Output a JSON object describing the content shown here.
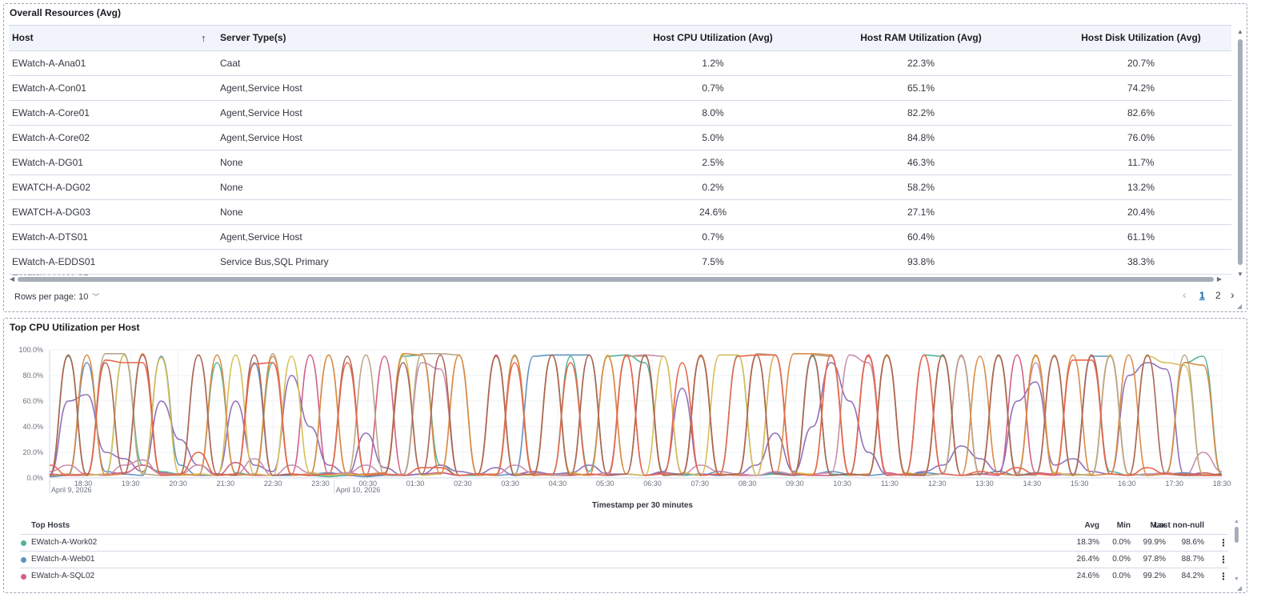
{
  "table_panel": {
    "title": "Overall Resources (Avg)",
    "columns": [
      "Host",
      "Server Type(s)",
      "Host CPU Utilization (Avg)",
      "Host RAM Utilization (Avg)",
      "Host Disk Utilization (Avg)"
    ],
    "sort_icon": "arrow-up-icon",
    "rows": [
      [
        "EWatch-A-Ana01",
        "Caat",
        "1.2%",
        "22.3%",
        "20.7%"
      ],
      [
        "EWatch-A-Con01",
        "Agent,Service Host",
        "0.7%",
        "65.1%",
        "74.2%"
      ],
      [
        "EWatch-A-Core01",
        "Agent,Service Host",
        "8.0%",
        "82.2%",
        "82.6%"
      ],
      [
        "EWatch-A-Core02",
        "Agent,Service Host",
        "5.0%",
        "84.8%",
        "76.0%"
      ],
      [
        "EWatch-A-DG01",
        "None",
        "2.5%",
        "46.3%",
        "11.7%"
      ],
      [
        "EWATCH-A-DG02",
        "None",
        "0.2%",
        "58.2%",
        "13.2%"
      ],
      [
        "EWATCH-A-DG03",
        "None",
        "24.6%",
        "27.1%",
        "20.4%"
      ],
      [
        "EWatch-A-DTS01",
        "Agent,Service Host",
        "0.7%",
        "60.4%",
        "61.1%"
      ],
      [
        "EWatch-A-EDDS01",
        "Service Bus,SQL Primary",
        "7.5%",
        "93.8%",
        "38.3%"
      ]
    ],
    "rows_per_page_label": "Rows per page: 10",
    "pages": [
      "1",
      "2"
    ],
    "current_page": "1"
  },
  "chart_panel": {
    "title": "Top CPU Utilization per Host",
    "legend_title": "Top Hosts",
    "legend_columns": [
      "Avg",
      "Min",
      "Max",
      "Last non-null"
    ],
    "legend_rows": [
      {
        "name": "EWatch-A-Work02",
        "color": "#54b399",
        "avg": "18.3%",
        "min": "0.0%",
        "max": "99.9%",
        "last": "98.6%"
      },
      {
        "name": "EWatch-A-Web01",
        "color": "#6092c0",
        "avg": "26.4%",
        "min": "0.0%",
        "max": "97.8%",
        "last": "88.7%"
      },
      {
        "name": "EWatch-A-SQL02",
        "color": "#d36086",
        "avg": "24.6%",
        "min": "0.0%",
        "max": "99.2%",
        "last": "84.2%"
      }
    ]
  },
  "chart_data": {
    "type": "line",
    "title": "Top CPU Utilization per Host",
    "xlabel": "Timestamp per 30 minutes",
    "ylabel": "",
    "y_ticks": [
      "0.0%",
      "20.0%",
      "40.0%",
      "60.0%",
      "80.0%",
      "100.0%"
    ],
    "ylim": [
      0,
      100
    ],
    "x_ticks": [
      "18:30",
      "19:30",
      "20:30",
      "21:30",
      "22:30",
      "23:30",
      "00:30",
      "01:30",
      "02:30",
      "03:30",
      "04:30",
      "05:30",
      "06:30",
      "07:30",
      "08:30",
      "09:30",
      "10:30",
      "11:30",
      "12:30",
      "13:30",
      "14:30",
      "15:30",
      "16:30",
      "17:30",
      "18:30"
    ],
    "x_date_labels": [
      {
        "at": "18:30",
        "text": "April 9, 2026"
      },
      {
        "at": "00:30",
        "text": "April 10, 2026"
      }
    ],
    "series_colors": [
      "#54b399",
      "#6092c0",
      "#d36086",
      "#9170b8",
      "#ca8eae",
      "#d6bf57",
      "#b9a888",
      "#da8b45",
      "#aa6556",
      "#e7664c"
    ],
    "series": [
      {
        "values": [
          2,
          95,
          3,
          2,
          96,
          10,
          5,
          3,
          2,
          90,
          4,
          2,
          90,
          3,
          2,
          1,
          2,
          3,
          4,
          95,
          96,
          10,
          2,
          2,
          3,
          96,
          4,
          2,
          95,
          5,
          95,
          96,
          90,
          4,
          2,
          3,
          2,
          96,
          2,
          3,
          2,
          95,
          3,
          2,
          96,
          2,
          3,
          96,
          95,
          2,
          3,
          5,
          2,
          96,
          4,
          2,
          96,
          5,
          2,
          3,
          4,
          90,
          95,
          3
        ]
      },
      {
        "values": [
          1,
          2,
          90,
          5,
          3,
          2,
          95,
          10,
          2,
          2,
          3,
          90,
          2,
          2,
          3,
          4,
          2,
          1,
          2,
          2,
          3,
          4,
          2,
          3,
          2,
          3,
          95,
          96,
          96,
          96,
          2,
          3,
          2,
          4,
          3,
          2,
          5,
          3,
          2,
          4,
          2,
          3,
          5,
          3,
          2,
          3,
          2,
          4,
          3,
          2,
          3,
          5,
          2,
          4,
          3,
          2,
          95,
          95,
          3,
          2,
          3,
          4,
          2,
          2
        ]
      },
      {
        "values": [
          3,
          2,
          2,
          3,
          4,
          10,
          4,
          2,
          3,
          2,
          12,
          2,
          2,
          3,
          96,
          3,
          4,
          2,
          95,
          2,
          3,
          4,
          2,
          3,
          96,
          3,
          5,
          2,
          2,
          3,
          2,
          96,
          2,
          4,
          2,
          96,
          3,
          2,
          2,
          96,
          3,
          2,
          2,
          3,
          96,
          4,
          2,
          2,
          3,
          95,
          3,
          2,
          96,
          4,
          3,
          3,
          2,
          96,
          3,
          2,
          3,
          2,
          4,
          2
        ]
      },
      {
        "values": [
          2,
          60,
          65,
          20,
          15,
          5,
          60,
          30,
          10,
          3,
          60,
          10,
          5,
          80,
          40,
          10,
          3,
          35,
          8,
          2,
          3,
          10,
          5,
          3,
          8,
          2,
          5,
          3,
          4,
          10,
          3,
          3,
          2,
          5,
          70,
          3,
          2,
          3,
          10,
          35,
          5,
          40,
          90,
          60,
          20,
          3,
          2,
          5,
          10,
          25,
          15,
          5,
          60,
          75,
          10,
          15,
          5,
          3,
          80,
          90,
          85,
          2,
          3,
          2
        ]
      },
      {
        "values": [
          5,
          10,
          3,
          2,
          10,
          14,
          3,
          3,
          10,
          2,
          3,
          15,
          2,
          10,
          4,
          2,
          4,
          10,
          3,
          2,
          90,
          85,
          2,
          3,
          3,
          10,
          4,
          2,
          3,
          2,
          4,
          95,
          96,
          95,
          3,
          10,
          5,
          3,
          2,
          5,
          3,
          3,
          4,
          96,
          90,
          3,
          2,
          96,
          4,
          95,
          3,
          96,
          4,
          90,
          2,
          3,
          95,
          3,
          2,
          3,
          4,
          2,
          20,
          5
        ]
      },
      {
        "values": [
          2,
          96,
          2,
          3,
          96,
          4,
          94,
          2,
          3,
          2,
          96,
          3,
          2,
          95,
          4,
          2,
          3,
          2,
          3,
          96,
          2,
          3,
          96,
          2,
          95,
          3,
          2,
          96,
          4,
          2,
          96,
          3,
          2,
          95,
          4,
          2,
          96,
          96,
          2,
          96,
          4,
          3,
          96,
          2,
          3,
          95,
          4,
          2,
          96,
          2,
          3,
          96,
          2,
          95,
          4,
          2,
          3,
          96,
          2,
          95,
          90,
          88,
          3,
          2
        ]
      },
      {
        "values": [
          2,
          3,
          2,
          97,
          97,
          3,
          2,
          2,
          96,
          3,
          2,
          3,
          97,
          3,
          2,
          96,
          3,
          96,
          2,
          3,
          97,
          97,
          96,
          3,
          2,
          96,
          3,
          2,
          3,
          96,
          2,
          95,
          95,
          3,
          2,
          96,
          3,
          2,
          97,
          96,
          4,
          96,
          95,
          2,
          3,
          96,
          3,
          2,
          3,
          96,
          2,
          95,
          3,
          2,
          96,
          3,
          2,
          95,
          3,
          2,
          3,
          96,
          2,
          2
        ]
      },
      {
        "values": [
          2,
          3,
          96,
          2,
          3,
          97,
          2,
          3,
          2,
          96,
          3,
          2,
          95,
          2,
          3,
          96,
          2,
          3,
          4,
          97,
          96,
          3,
          96,
          2,
          3,
          95,
          2,
          96,
          3,
          2,
          95,
          3,
          96,
          2,
          3,
          96,
          3,
          2,
          96,
          3,
          97,
          97,
          96,
          2,
          3,
          96,
          2,
          3,
          96,
          2,
          95,
          3,
          2,
          96,
          3,
          96,
          2,
          3,
          96,
          2,
          3,
          90,
          88,
          2
        ]
      },
      {
        "values": [
          2,
          96,
          2,
          90,
          3,
          96,
          2,
          3,
          96,
          3,
          2,
          96,
          2,
          3,
          2,
          3,
          95,
          2,
          3,
          90,
          3,
          96,
          2,
          3,
          95,
          2,
          3,
          96,
          2,
          96,
          2,
          3,
          96,
          2,
          3,
          95,
          2,
          3,
          96,
          3,
          2,
          96,
          2,
          3,
          2,
          96,
          3,
          2,
          96,
          2,
          3,
          96,
          2,
          3,
          95,
          2,
          96,
          3,
          2,
          96,
          3,
          2,
          2,
          3
        ]
      },
      {
        "values": [
          10,
          2,
          3,
          92,
          90,
          90,
          2,
          3,
          20,
          2,
          3,
          89,
          90,
          3,
          2,
          3,
          90,
          2,
          3,
          2,
          8,
          8,
          2,
          3,
          2,
          90,
          2,
          3,
          90,
          3,
          2,
          96,
          2,
          3,
          90,
          2,
          3,
          95,
          96,
          96,
          3,
          2,
          96,
          3,
          95,
          2,
          3,
          96,
          3,
          2,
          5,
          3,
          8,
          3,
          2,
          92,
          92,
          3,
          2,
          8,
          3,
          3,
          2,
          2
        ]
      }
    ]
  }
}
